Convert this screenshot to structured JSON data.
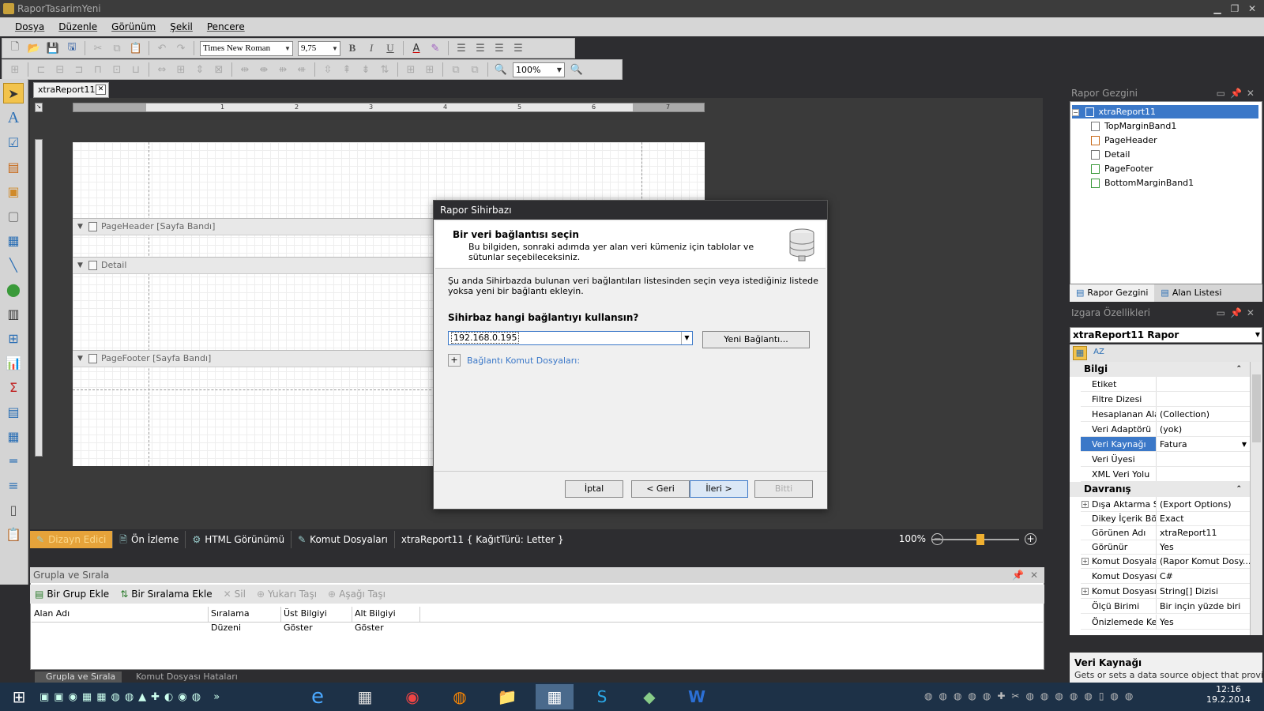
{
  "window": {
    "title": "RaporTasarimYeni"
  },
  "menu": [
    "Dosya",
    "Düzenle",
    "Görünüm",
    "Şekil",
    "Pencere"
  ],
  "toolbar": {
    "font_name": "Times New Roman",
    "font_size": "9,75",
    "zoom": "100%"
  },
  "doc_tab": {
    "label": "xtraReport11"
  },
  "bands": [
    {
      "label": "PageHeader [Sayfa Bandı]"
    },
    {
      "label": "Detail"
    },
    {
      "label": "PageFooter [Sayfa Bandı]"
    }
  ],
  "status": {
    "tabs": [
      "Dizayn Edici",
      "Ön İzleme",
      "HTML Görünümü",
      "Komut Dosyaları"
    ],
    "info": "xtraReport11 { KağıtTürü: Letter }",
    "zoom": "100%"
  },
  "group_panel": {
    "title": "Grupla ve Sırala",
    "buttons": [
      "Bir Grup Ekle",
      "Bir Sıralama Ekle",
      "Sil",
      "Yukarı Taşı",
      "Aşağı Taşı"
    ],
    "columns": [
      "Alan Adı",
      "Sıralama Düzeni",
      "Üst Bilgiyi Göster",
      "Alt Bilgiyi Göster"
    ]
  },
  "bottom_tabs": [
    "Grupla ve Sırala",
    "Komut Dosyası Hataları"
  ],
  "report_explorer": {
    "title": "Rapor Gezgini",
    "root": "xtraReport11",
    "nodes": [
      "TopMarginBand1",
      "PageHeader",
      "Detail",
      "PageFooter",
      "BottomMarginBand1"
    ],
    "tabs": [
      "Rapor Gezgini",
      "Alan Listesi"
    ]
  },
  "properties": {
    "title": "Izgara Özellikleri",
    "object": "xtraReport11  Rapor",
    "cat1": "Bilgi",
    "rows1": [
      {
        "name": "Etiket",
        "value": ""
      },
      {
        "name": "Filtre Dizesi",
        "value": ""
      },
      {
        "name": "Hesaplanan Alanl",
        "value": "(Collection)"
      },
      {
        "name": "Veri Adaptörü",
        "value": "(yok)"
      },
      {
        "name": "Veri Kaynağı",
        "value": "Fatura"
      },
      {
        "name": "Veri Üyesi",
        "value": ""
      },
      {
        "name": "XML Veri Yolu",
        "value": ""
      }
    ],
    "cat2": "Davranış",
    "rows2": [
      {
        "name": "Dışa Aktarma Seç",
        "value": "(Export Options)"
      },
      {
        "name": "Dikey İçerik Bölme",
        "value": "Exact"
      },
      {
        "name": "Görünen Adı",
        "value": "xtraReport11"
      },
      {
        "name": "Görünür",
        "value": "Yes"
      },
      {
        "name": "Komut Dosyaları",
        "value": "(Rapor Komut Dosy..."
      },
      {
        "name": "Komut Dosyası Di",
        "value": "C#"
      },
      {
        "name": "Komut Dosyası Re",
        "value": "String[] Dizisi"
      },
      {
        "name": "Ölçü Birimi",
        "value": "Bir inçin yüzde biri"
      },
      {
        "name": "Önizlemede Kena",
        "value": "Yes"
      }
    ],
    "desc_title": "Veri Kaynağı",
    "desc_text": "Gets or sets a data source object that provides"
  },
  "dialog": {
    "title": "Rapor Sihirbazı",
    "heading": "Bir veri bağlantısı seçin",
    "subheading": "Bu bilgiden, sonraki adımda yer alan veri kümeniz için tablolar ve sütunlar seçebileceksiniz.",
    "info": "Şu anda Sihirbazda bulunan veri bağlantıları listesinden seçin veya istediğiniz listede yoksa yeni bir bağlantı ekleyin.",
    "question": "Sihirbaz hangi bağlantıyı kullansın?",
    "connection": "192.168.0.195",
    "new_connection": "Yeni Bağlantı...",
    "scripts_link": "Bağlantı Komut Dosyaları:",
    "btn_cancel": "İptal",
    "btn_back": "< Geri",
    "btn_next": "İleri >",
    "btn_finish": "Bitti"
  },
  "clock": {
    "time": "12:16",
    "date": "19.2.2014"
  }
}
